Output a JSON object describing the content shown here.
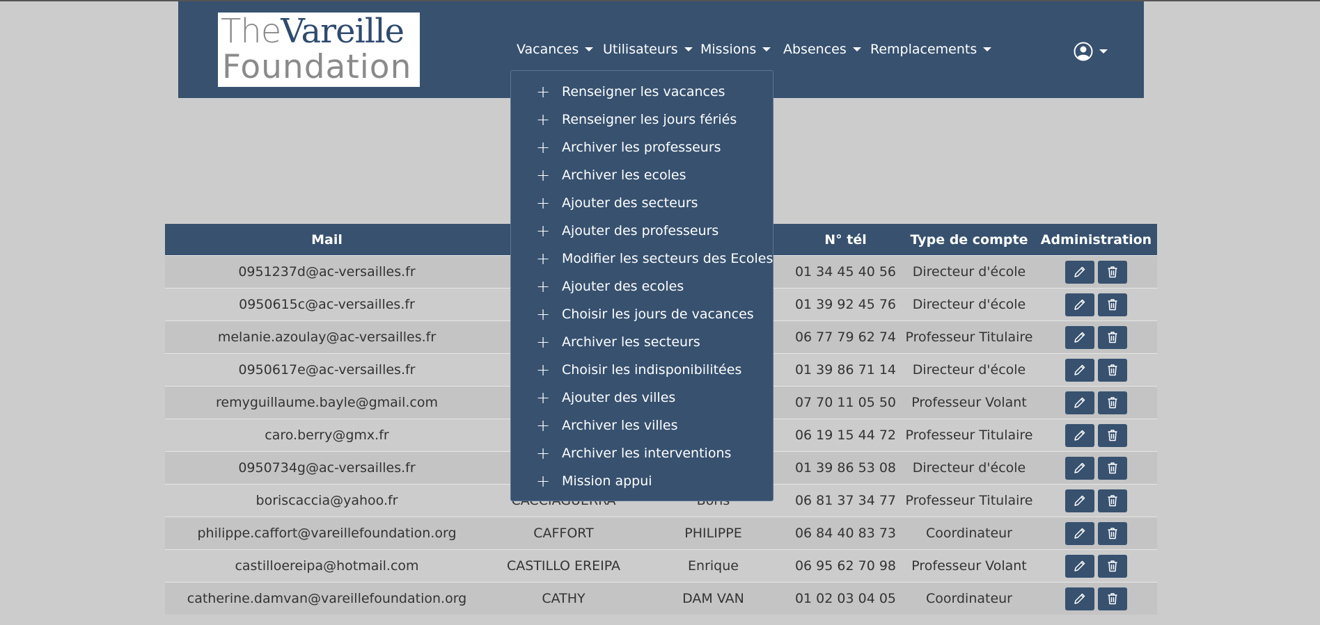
{
  "logo": {
    "line1_the": "The",
    "line1_name": "Vareille",
    "line2": "Foundation"
  },
  "nav": {
    "vacances": "Vacances",
    "utilisateurs": "Utilisateurs",
    "missions": "Missions",
    "absences": "Absences",
    "remplacements": "Remplacements"
  },
  "dropdown": {
    "items": [
      "Renseigner les vacances",
      "Renseigner les jours fériés",
      "Archiver les professeurs",
      "Archiver les ecoles",
      "Ajouter des secteurs",
      "Ajouter des professeurs",
      "Modifier les secteurs des Ecoles",
      "Ajouter des ecoles",
      "Choisir les jours de vacances",
      "Archiver les secteurs",
      "Choisir les indisponibilitées",
      "Ajouter des villes",
      "Archiver les villes",
      "Archiver les interventions",
      "Mission appui"
    ]
  },
  "table": {
    "headers": {
      "mail": "Mail",
      "tel": "N° tél",
      "type": "Type de compte",
      "admin": "Administration"
    },
    "rows": [
      {
        "mail": "0951237d@ac-versailles.fr",
        "nom": "",
        "prenom": "",
        "tel": "01 34 45 40 56",
        "type": "Directeur d'école"
      },
      {
        "mail": "0950615c@ac-versailles.fr",
        "nom": "",
        "prenom": "",
        "tel": "01 39 92 45 76",
        "type": "Directeur d'école"
      },
      {
        "mail": "melanie.azoulay@ac-versailles.fr",
        "nom": "",
        "prenom": "",
        "tel": "06 77 79 62 74",
        "type": "Professeur Titulaire"
      },
      {
        "mail": "0950617e@ac-versailles.fr",
        "nom": "",
        "prenom": "",
        "tel": "01 39 86 71 14",
        "type": "Directeur d'école"
      },
      {
        "mail": "remyguillaume.bayle@gmail.com",
        "nom": "",
        "prenom": "",
        "tel": "07 70 11 05 50",
        "type": "Professeur Volant"
      },
      {
        "mail": "caro.berry@gmx.fr",
        "nom": "",
        "prenom": "",
        "tel": "06 19 15 44 72",
        "type": "Professeur Titulaire"
      },
      {
        "mail": "0950734g@ac-versailles.fr",
        "nom": "",
        "prenom": "",
        "tel": "01 39 86 53 08",
        "type": "Directeur d'école"
      },
      {
        "mail": "boriscaccia@yahoo.fr",
        "nom": "CACCIAGUERRA",
        "prenom": "Boris",
        "tel": "06 81 37 34 77",
        "type": "Professeur Titulaire"
      },
      {
        "mail": "philippe.caffort@vareillefoundation.org",
        "nom": "CAFFORT",
        "prenom": "PHILIPPE",
        "tel": "06 84 40 83 73",
        "type": "Coordinateur"
      },
      {
        "mail": "castilloereipa@hotmail.com",
        "nom": "CASTILLO EREIPA",
        "prenom": "Enrique",
        "tel": "06 95 62 70 98",
        "type": "Professeur Volant"
      },
      {
        "mail": "catherine.damvan@vareillefoundation.org",
        "nom": "CATHY",
        "prenom": "DAM VAN",
        "tel": "01 02 03 04 05",
        "type": "Coordinateur"
      }
    ]
  },
  "colors": {
    "navbar": "#37516f",
    "page_bg": "#cccccc",
    "row_alt": "#c4c4c4"
  },
  "icons": {
    "user": "user-circle-icon",
    "edit": "pencil-icon",
    "delete": "trash-icon",
    "dropdown_item": "plus-icon"
  }
}
